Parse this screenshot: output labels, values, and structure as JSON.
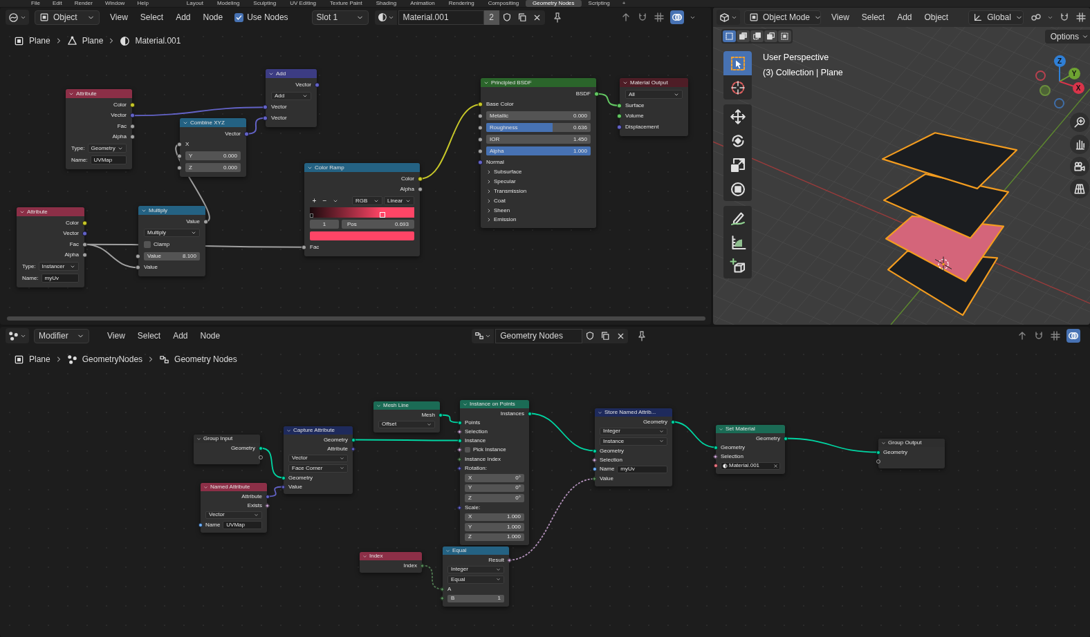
{
  "top_bar": {
    "menus": [
      "File",
      "Edit",
      "Render",
      "Window",
      "Help"
    ],
    "workspaces": [
      {
        "label": "Layout",
        "selected": false
      },
      {
        "label": "Modeling",
        "selected": false
      },
      {
        "label": "Sculpting",
        "selected": false
      },
      {
        "label": "UV Editing",
        "selected": false
      },
      {
        "label": "Texture Paint",
        "selected": false
      },
      {
        "label": "Shading",
        "selected": false
      },
      {
        "label": "Animation",
        "selected": false
      },
      {
        "label": "Rendering",
        "selected": false
      },
      {
        "label": "Compositing",
        "selected": false
      },
      {
        "label": "Geometry Nodes",
        "selected": true
      },
      {
        "label": "Scripting",
        "selected": false
      }
    ],
    "add_tab": "+"
  },
  "shader_editor": {
    "header": {
      "mode": "Object",
      "menus": [
        "View",
        "Select",
        "Add",
        "Node"
      ],
      "use_nodes": {
        "label": "Use Nodes",
        "checked": true
      },
      "slot": "Slot 1",
      "material": "Material.001",
      "users": "2"
    },
    "breadcrumb": [
      {
        "kind": "object",
        "label": "Plane"
      },
      {
        "kind": "mesh",
        "label": "Plane"
      },
      {
        "kind": "material",
        "label": "Material.001"
      }
    ],
    "nodes": [
      {
        "title": "Attribute",
        "color": "#8c2f47",
        "rows": [
          {
            "kind": "out",
            "label": "Color",
            "socket": {
              "kind": "color"
            }
          },
          {
            "kind": "out",
            "label": "Vector",
            "socket": {
              "kind": "vector"
            }
          },
          {
            "kind": "out",
            "label": "Fac",
            "socket": {
              "kind": "float"
            }
          },
          {
            "kind": "out",
            "label": "Alpha",
            "socket": {
              "kind": "float"
            }
          },
          {
            "kind": "dropdown",
            "label": "Type:",
            "value": "Geometry"
          },
          {
            "kind": "text",
            "label": "Name:",
            "value": "UVMap"
          }
        ]
      },
      {
        "title": "Add",
        "color": "#3c3c83",
        "rows": [
          {
            "kind": "out",
            "label": "Vector",
            "socket": {
              "kind": "vector"
            }
          },
          {
            "kind": "dropdown",
            "value": "Add"
          },
          {
            "kind": "in",
            "label": "Vector",
            "socket": {
              "kind": "vector"
            }
          },
          {
            "kind": "in",
            "label": "Vector",
            "socket": {
              "kind": "vector"
            }
          }
        ]
      },
      {
        "title": "Combine XYZ",
        "color": "#246283",
        "rows": [
          {
            "kind": "out",
            "label": "Vector",
            "socket": {
              "kind": "vector"
            }
          },
          {
            "kind": "in",
            "label": "X",
            "socket": {
              "kind": "float"
            }
          },
          {
            "kind": "field",
            "label": "Y",
            "value": "0.000",
            "socket": {
              "kind": "float"
            }
          },
          {
            "kind": "field",
            "label": "Z",
            "value": "0.000",
            "socket": {
              "kind": "float"
            }
          }
        ]
      },
      {
        "title": "Color Ramp",
        "color": "#246283",
        "rows": [
          {
            "kind": "out",
            "label": "Color",
            "socket": {
              "kind": "color"
            }
          },
          {
            "kind": "out",
            "label": "Alpha",
            "socket": {
              "kind": "float"
            }
          },
          {
            "kind": "ramp_tools",
            "buttons": [
              "+",
              "−"
            ],
            "modes": [
              "RGB",
              "Linear"
            ]
          },
          {
            "kind": "ramp",
            "level": 0.693
          },
          {
            "kind": "stop",
            "index": "1",
            "label": "Pos",
            "value": "0.693"
          },
          {
            "kind": "swatch",
            "color": "#ff4566"
          },
          {
            "kind": "in",
            "label": "Fac",
            "socket": {
              "kind": "float"
            }
          }
        ]
      },
      {
        "title": "Principled BSDF",
        "color": "#2b652b",
        "rows": [
          {
            "kind": "out",
            "label": "BSDF",
            "socket": {
              "kind": "shader"
            }
          },
          {
            "kind": "in",
            "label": "Base Color",
            "socket": {
              "kind": "color"
            }
          },
          {
            "kind": "field",
            "label": "Metallic",
            "value": "0.000",
            "socket": {
              "kind": "float"
            }
          },
          {
            "kind": "field",
            "label": "Roughness",
            "value": "0.636",
            "socket": {
              "kind": "float"
            },
            "level": 0.636
          },
          {
            "kind": "field",
            "label": "IOR",
            "value": "1.450",
            "socket": {
              "kind": "float"
            }
          },
          {
            "kind": "field",
            "label": "Alpha",
            "value": "1.000",
            "socket": {
              "kind": "float"
            },
            "level": 1
          },
          {
            "kind": "in",
            "label": "Normal",
            "socket": {
              "kind": "vector"
            }
          },
          {
            "kind": "panel",
            "label": "Subsurface",
            "expanded": false
          },
          {
            "kind": "panel",
            "label": "Specular",
            "expanded": false
          },
          {
            "kind": "panel",
            "label": "Transmission",
            "expanded": false
          },
          {
            "kind": "panel",
            "label": "Coat",
            "expanded": false
          },
          {
            "kind": "panel",
            "label": "Sheen",
            "expanded": false
          },
          {
            "kind": "panel",
            "label": "Emission",
            "expanded": false
          }
        ]
      },
      {
        "title": "Material Output",
        "color": "#4e1d26",
        "rows": [
          {
            "kind": "dropdown",
            "value": "All"
          },
          {
            "kind": "in",
            "label": "Surface",
            "socket": {
              "kind": "shader"
            }
          },
          {
            "kind": "in",
            "label": "Volume",
            "socket": {
              "kind": "shader"
            }
          },
          {
            "kind": "in",
            "label": "Displacement",
            "socket": {
              "kind": "vector"
            }
          }
        ]
      },
      {
        "title": "Attribute",
        "color": "#8c2f47",
        "rows": [
          {
            "kind": "out",
            "label": "Color",
            "socket": {
              "kind": "color"
            }
          },
          {
            "kind": "out",
            "label": "Vector",
            "socket": {
              "kind": "vector"
            }
          },
          {
            "kind": "out",
            "label": "Fac",
            "socket": {
              "kind": "float"
            }
          },
          {
            "kind": "out",
            "label": "Alpha",
            "socket": {
              "kind": "float"
            }
          },
          {
            "kind": "dropdown",
            "label": "Type:",
            "value": "Instancer"
          },
          {
            "kind": "text",
            "label": "Name:",
            "value": "myUv"
          }
        ]
      },
      {
        "title": "Multiply",
        "color": "#246283",
        "rows": [
          {
            "kind": "out",
            "label": "Value",
            "socket": {
              "kind": "float"
            }
          },
          {
            "kind": "dropdown",
            "value": "Multiply"
          },
          {
            "kind": "checkbox",
            "label": "Clamp",
            "checked": false
          },
          {
            "kind": "field",
            "label": "Value",
            "value": "8.100",
            "socket": {
              "kind": "float"
            }
          },
          {
            "kind": "in",
            "label": "Value",
            "socket": {
              "kind": "float"
            }
          }
        ]
      }
    ]
  },
  "viewport": {
    "header": {
      "mode": "Object Mode",
      "menus": [
        "View",
        "Select",
        "Add",
        "Object"
      ],
      "orientation": "Global"
    },
    "select_modes": [
      {
        "kind": "new",
        "selected": true
      },
      {
        "kind": "extend",
        "selected": false
      },
      {
        "kind": "subtract",
        "selected": false
      },
      {
        "kind": "invert",
        "selected": false
      },
      {
        "kind": "intersect",
        "selected": false
      }
    ],
    "options": "Options",
    "tools": [
      {
        "kind": "select",
        "selected": true
      },
      {
        "kind": "cursor",
        "selected": false
      },
      {
        "kind": "move",
        "selected": false
      },
      {
        "kind": "rotate",
        "selected": false
      },
      {
        "kind": "scale",
        "selected": false
      },
      {
        "kind": "transform",
        "selected": false
      },
      {
        "kind": "annotate",
        "selected": false
      },
      {
        "kind": "measure",
        "selected": false
      },
      {
        "kind": "add_cube",
        "selected": false
      }
    ],
    "overlay_text": [
      "User Perspective",
      "(3) Collection | Plane"
    ],
    "gizmo": [
      "Z",
      "Y",
      "X"
    ]
  },
  "geometry_editor": {
    "header": {
      "mode": "Modifier",
      "menus": [
        "View",
        "Select",
        "Add",
        "Node"
      ],
      "node_group": "Geometry Nodes"
    },
    "breadcrumb": [
      {
        "kind": "object",
        "label": "Plane"
      },
      {
        "kind": "modifier",
        "label": "GeometryNodes"
      },
      {
        "kind": "node_tree",
        "label": "Geometry Nodes"
      }
    ],
    "nodes": [
      {
        "title": "Group Input",
        "color": "#2e2e2e",
        "rows": [
          {
            "kind": "out",
            "label": "Geometry",
            "socket": {
              "kind": "geometry"
            }
          },
          {
            "kind": "virtual_out"
          }
        ]
      },
      {
        "title": "Named Attribute",
        "color": "#8c2f47",
        "rows": [
          {
            "kind": "out",
            "label": "Attribute",
            "socket": {
              "kind": "vector"
            }
          },
          {
            "kind": "out",
            "label": "Exists",
            "socket": {
              "kind": "bool_field"
            }
          },
          {
            "kind": "dropdown",
            "value": "Vector"
          },
          {
            "kind": "text",
            "label": "Name",
            "value": "UVMap",
            "socket": {
              "kind": "string"
            }
          }
        ]
      },
      {
        "title": "Capture Attribute",
        "color": "#1e2a5c",
        "rows": [
          {
            "kind": "out",
            "label": "Geometry",
            "socket": {
              "kind": "geometry"
            }
          },
          {
            "kind": "out",
            "label": "Attribute",
            "socket": {
              "kind": "vector_field"
            }
          },
          {
            "kind": "dropdown",
            "value": "Vector"
          },
          {
            "kind": "dropdown",
            "value": "Face Corner"
          },
          {
            "kind": "in",
            "label": "Geometry",
            "socket": {
              "kind": "geometry"
            }
          },
          {
            "kind": "in",
            "label": "Value",
            "socket": {
              "kind": "vector_field"
            }
          }
        ]
      },
      {
        "title": "Mesh Line",
        "color": "#1b6b55",
        "rows": [
          {
            "kind": "out",
            "label": "Mesh",
            "socket": {
              "kind": "geometry"
            }
          },
          {
            "kind": "dropdown",
            "value": "Offset"
          }
        ]
      },
      {
        "title": "Instance on Points",
        "color": "#1b6b55",
        "rows": [
          {
            "kind": "out",
            "label": "Instances",
            "socket": {
              "kind": "geometry"
            }
          },
          {
            "kind": "in",
            "label": "Points",
            "socket": {
              "kind": "geometry"
            }
          },
          {
            "kind": "in",
            "label": "Selection",
            "socket": {
              "kind": "bool_field"
            }
          },
          {
            "kind": "in",
            "label": "Instance",
            "socket": {
              "kind": "geometry"
            }
          },
          {
            "kind": "checkbox",
            "label": "Pick Instance",
            "checked": false,
            "socket": {
              "kind": "bool_field"
            }
          },
          {
            "kind": "in",
            "label": "Instance Index",
            "socket": {
              "kind": "int_field"
            }
          },
          {
            "kind": "heading",
            "label": "Rotation:",
            "socket": {
              "kind": "vector_field"
            }
          },
          {
            "kind": "field",
            "label": "X",
            "value": "0°"
          },
          {
            "kind": "field",
            "label": "Y",
            "value": "0°"
          },
          {
            "kind": "field",
            "label": "Z",
            "value": "0°"
          },
          {
            "kind": "heading",
            "label": "Scale:",
            "socket": {
              "kind": "vector_field"
            }
          },
          {
            "kind": "field",
            "label": "X",
            "value": "1.000"
          },
          {
            "kind": "field",
            "label": "Y",
            "value": "1.000"
          },
          {
            "kind": "field",
            "label": "Z",
            "value": "1.000"
          }
        ]
      },
      {
        "title": "Index",
        "color": "#8c2f47",
        "rows": [
          {
            "kind": "out",
            "label": "Index",
            "socket": {
              "kind": "int_field"
            }
          }
        ]
      },
      {
        "title": "Equal",
        "color": "#246283",
        "rows": [
          {
            "kind": "out",
            "label": "Result",
            "socket": {
              "kind": "bool_field"
            }
          },
          {
            "kind": "dropdown",
            "value": "Integer"
          },
          {
            "kind": "dropdown",
            "value": "Equal"
          },
          {
            "kind": "in",
            "label": "A",
            "socket": {
              "kind": "int_field"
            }
          },
          {
            "kind": "field",
            "label": "B",
            "value": "1",
            "socket": {
              "kind": "int_field"
            }
          }
        ]
      },
      {
        "title": "Store Named Attrib...",
        "color": "#1e2a5c",
        "rows": [
          {
            "kind": "out",
            "label": "Geometry",
            "socket": {
              "kind": "geometry"
            }
          },
          {
            "kind": "dropdown",
            "value": "Integer"
          },
          {
            "kind": "dropdown",
            "value": "Instance"
          },
          {
            "kind": "in",
            "label": "Geometry",
            "socket": {
              "kind": "geometry"
            }
          },
          {
            "kind": "in",
            "label": "Selection",
            "socket": {
              "kind": "bool_field"
            }
          },
          {
            "kind": "text",
            "label": "Name",
            "value": "myUv",
            "socket": {
              "kind": "string"
            }
          },
          {
            "kind": "in",
            "label": "Value",
            "socket": {
              "kind": "int_field"
            }
          }
        ]
      },
      {
        "title": "Set Material",
        "color": "#1b6b55",
        "rows": [
          {
            "kind": "out",
            "label": "Geometry",
            "socket": {
              "kind": "geometry"
            }
          },
          {
            "kind": "in",
            "label": "Geometry",
            "socket": {
              "kind": "geometry"
            }
          },
          {
            "kind": "in",
            "label": "Selection",
            "socket": {
              "kind": "bool_field"
            }
          },
          {
            "kind": "material",
            "value": "Material.001",
            "socket": {
              "kind": "material"
            }
          }
        ]
      },
      {
        "title": "Group Output",
        "color": "#2e2e2e",
        "rows": [
          {
            "kind": "in",
            "label": "Geometry",
            "socket": {
              "kind": "geometry"
            }
          },
          {
            "kind": "virtual_in"
          }
        ]
      }
    ]
  }
}
